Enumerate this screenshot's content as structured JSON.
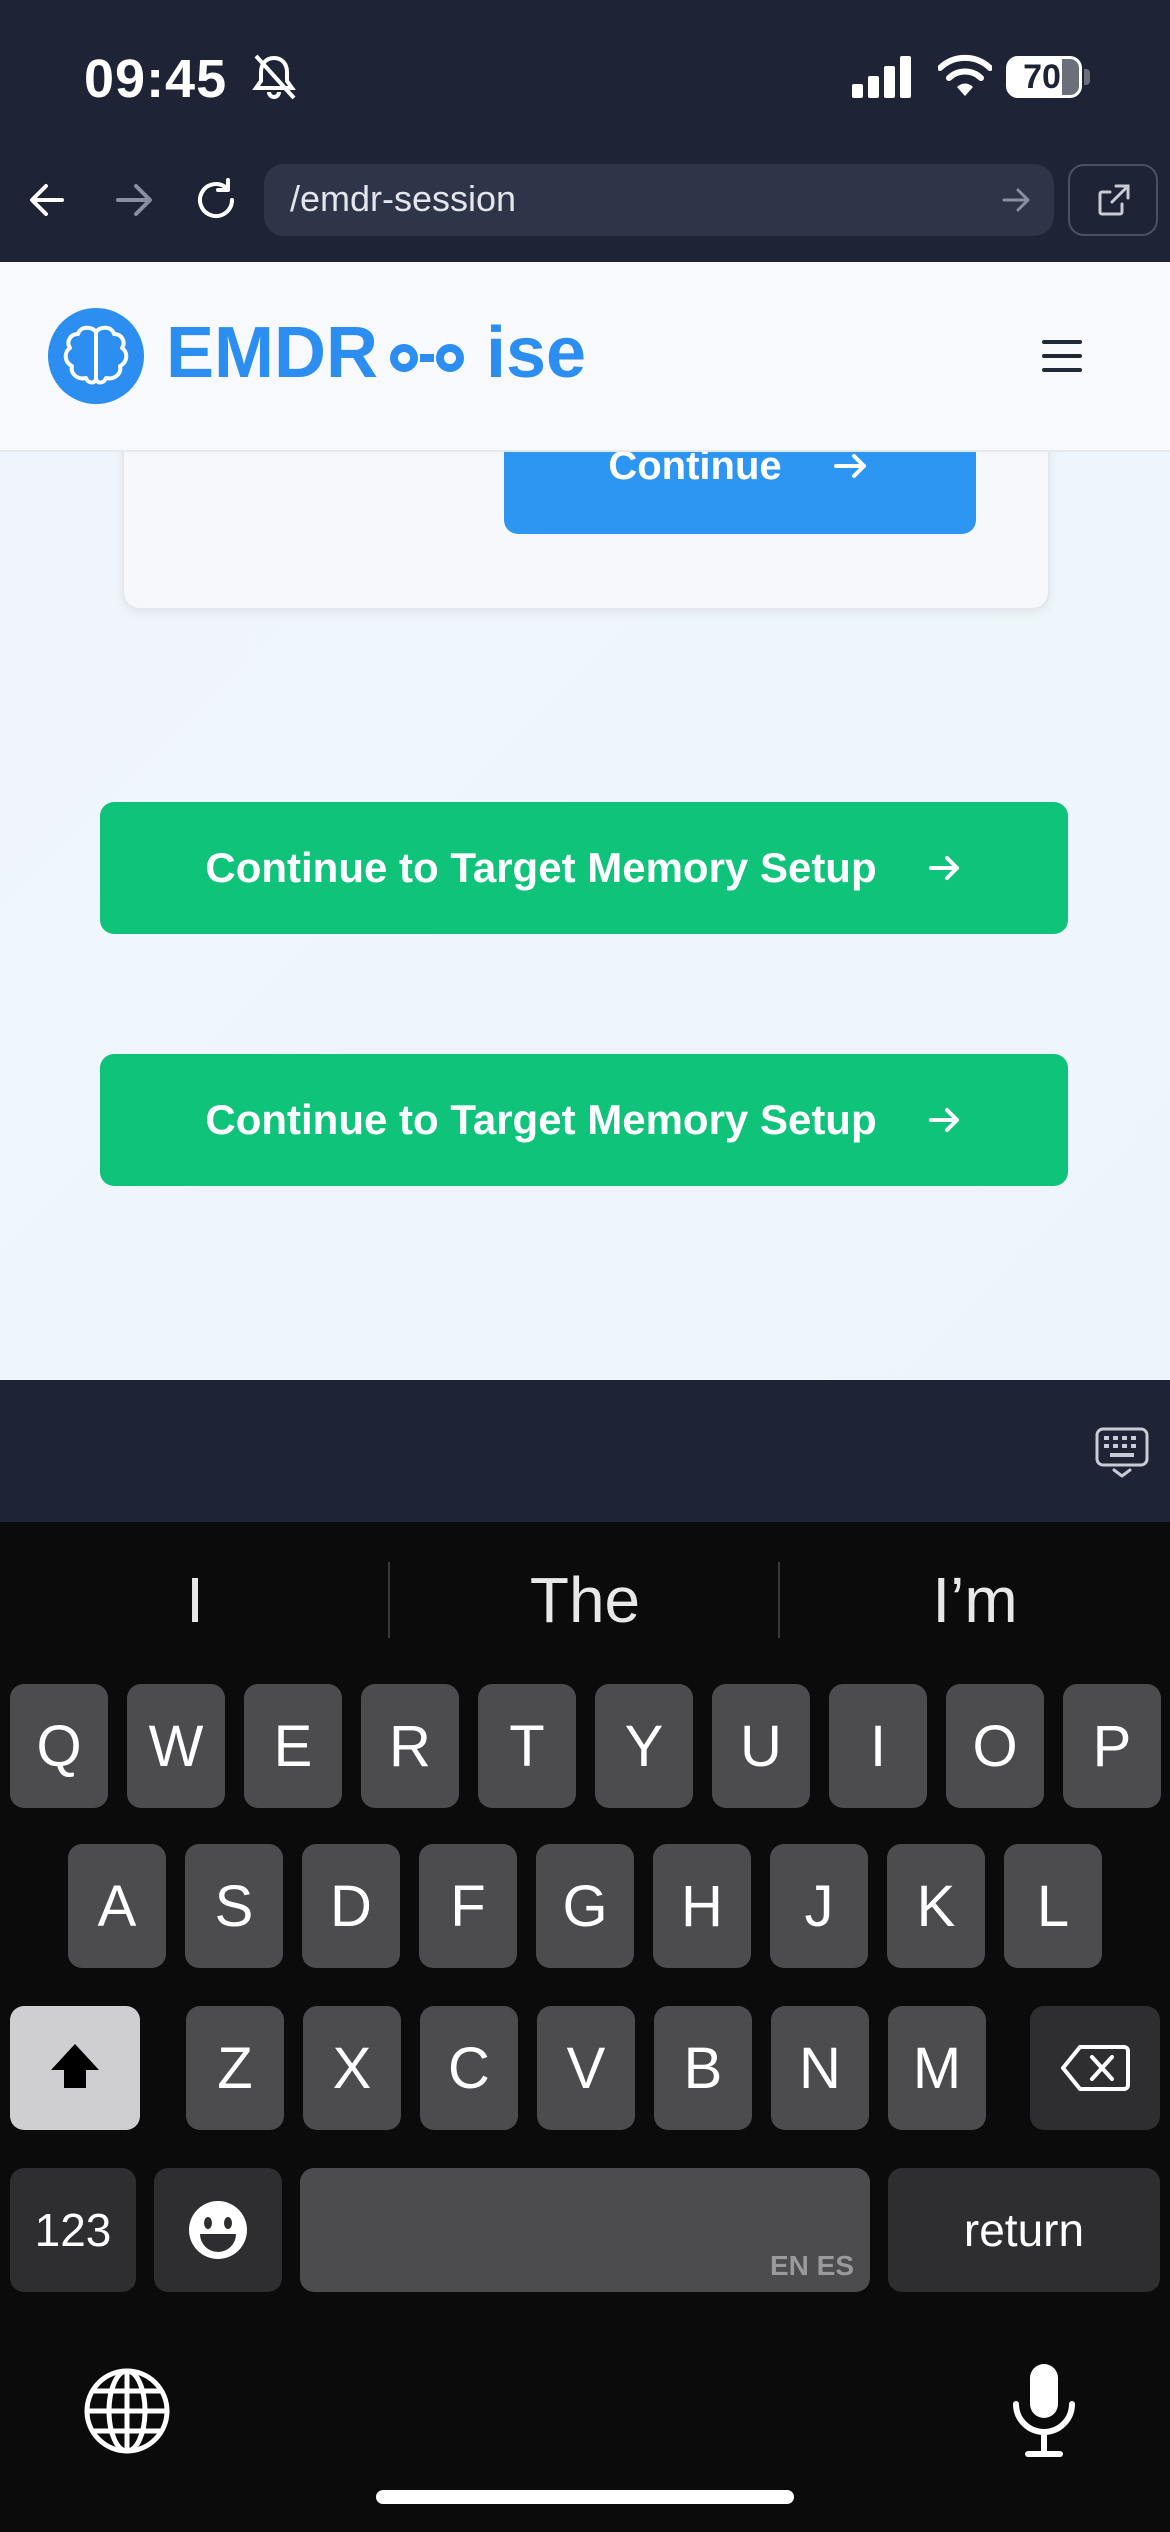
{
  "status_bar": {
    "time": "09:45",
    "battery_level": "70"
  },
  "browser": {
    "url": "/emdr-session"
  },
  "app": {
    "logo_text_left": "EMDR",
    "logo_text_right": "ise"
  },
  "content": {
    "card_button_label": "Continue",
    "primary_buttons": [
      {
        "label": "Continue to Target Memory Setup"
      },
      {
        "label": "Continue to Target Memory Setup"
      }
    ]
  },
  "keyboard": {
    "suggestions": [
      "I",
      "The",
      "I’m"
    ],
    "row1": [
      "Q",
      "W",
      "E",
      "R",
      "T",
      "Y",
      "U",
      "I",
      "O",
      "P"
    ],
    "row2": [
      "A",
      "S",
      "D",
      "F",
      "G",
      "H",
      "J",
      "K",
      "L"
    ],
    "row3": [
      "Z",
      "X",
      "C",
      "V",
      "B",
      "N",
      "M"
    ],
    "numbers_label": "123",
    "space_language": "EN ES",
    "return_label": "return"
  },
  "colors": {
    "brand_blue": "#2b8ef0",
    "green": "#10c37a",
    "header_dark": "#1e2436"
  }
}
